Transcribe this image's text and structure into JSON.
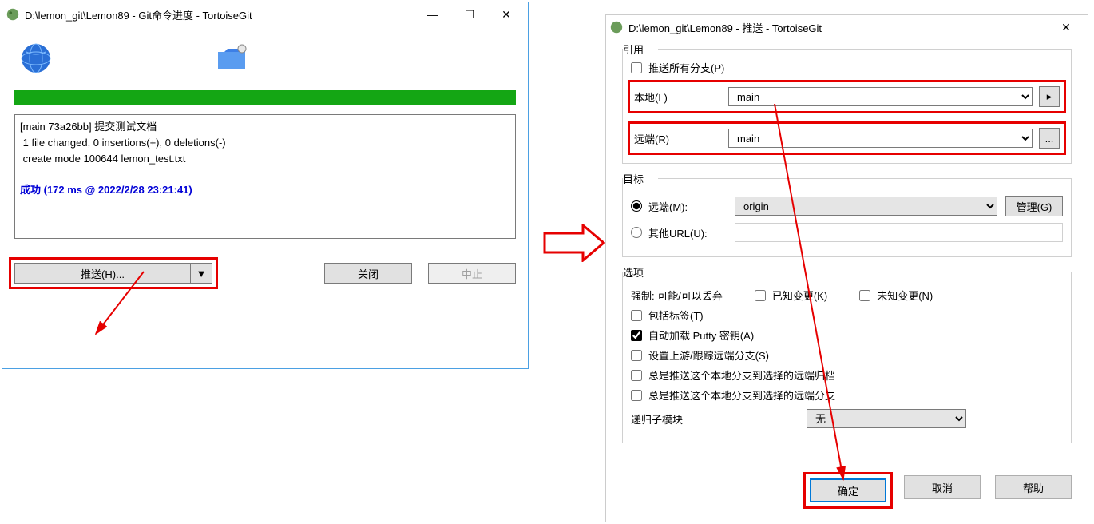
{
  "w1": {
    "title": "D:\\lemon_git\\Lemon89 - Git命令进度 - TortoiseGit",
    "output_line1": "[main 73a26bb] 提交测试文档",
    "output_line2": " 1 file changed, 0 insertions(+), 0 deletions(-)",
    "output_line3": " create mode 100644 lemon_test.txt",
    "output_blank": "",
    "output_success": "成功 (172 ms @ 2022/2/28 23:21:41)",
    "push_btn": "推送(H)...",
    "close_btn": "关闭",
    "abort_btn": "中止"
  },
  "w2": {
    "title": "D:\\lemon_git\\Lemon89 - 推送 - TortoiseGit",
    "ref_legend": "引用",
    "push_all": "推送所有分支(P)",
    "local_lbl": "本地(L)",
    "local_val": "main",
    "remote_branch_lbl": "远端(R)",
    "remote_branch_val": "main",
    "target_legend": "目标",
    "remote_lbl": "远端(M):",
    "remote_val": "origin",
    "manage_btn": "管理(G)",
    "other_url_lbl": "其他URL(U):",
    "opts_legend": "选项",
    "force_lbl": "强制: 可能/可以丢弃",
    "known_change": "已知变更(K)",
    "unknown_change": "未知变更(N)",
    "include_tags": "包括标签(T)",
    "autoload_putty": "自动加载 Putty 密钥(A)",
    "set_upstream": "设置上游/跟踪远端分支(S)",
    "always_push_archive": "总是推送这个本地分支到选择的远端归档",
    "always_push_branch": "总是推送这个本地分支到选择的远端分支",
    "recursive_lbl": "递归子模块",
    "recursive_val": "无",
    "ok_btn": "确定",
    "cancel_btn": "取消",
    "help_btn": "帮助"
  },
  "ellipsis": "..."
}
